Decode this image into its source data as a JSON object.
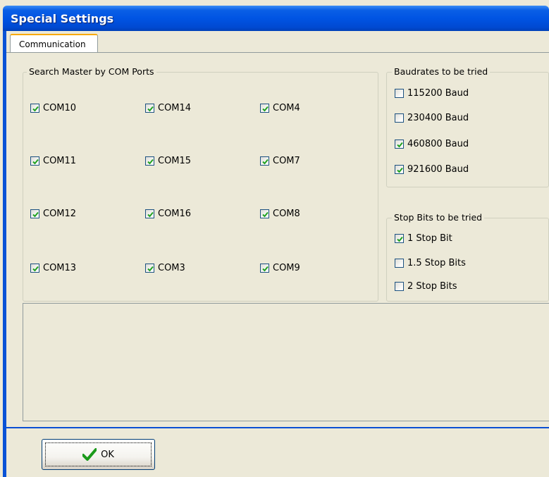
{
  "window": {
    "title": "Special Settings"
  },
  "tabs": [
    {
      "label": "Communication"
    }
  ],
  "com_group": {
    "label": "Search Master by COM Ports",
    "ports": [
      {
        "label": "COM10",
        "checked": true
      },
      {
        "label": "COM14",
        "checked": true
      },
      {
        "label": "COM4",
        "checked": true
      },
      {
        "label": "COM11",
        "checked": true
      },
      {
        "label": "COM15",
        "checked": true
      },
      {
        "label": "COM7",
        "checked": true
      },
      {
        "label": "COM12",
        "checked": true
      },
      {
        "label": "COM16",
        "checked": true
      },
      {
        "label": "COM8",
        "checked": true
      },
      {
        "label": "COM13",
        "checked": true
      },
      {
        "label": "COM3",
        "checked": true
      },
      {
        "label": "COM9",
        "checked": true
      }
    ]
  },
  "baud_group": {
    "label": "Baudrates to be tried",
    "options": [
      {
        "label": "115200 Baud",
        "checked": false
      },
      {
        "label": "230400 Baud",
        "checked": false
      },
      {
        "label": "460800 Baud",
        "checked": true
      },
      {
        "label": "921600 Baud",
        "checked": true
      }
    ]
  },
  "stop_group": {
    "label": "Stop Bits to be tried",
    "options": [
      {
        "label": "1 Stop Bit",
        "checked": true
      },
      {
        "label": "1.5 Stop Bits",
        "checked": false
      },
      {
        "label": "2 Stop Bits",
        "checked": false
      }
    ]
  },
  "ok_button": {
    "label": "OK",
    "icon": "checkmark-icon"
  },
  "colors": {
    "titlebar": "#0054e3",
    "face": "#ece9d8",
    "check": "#21a121"
  }
}
